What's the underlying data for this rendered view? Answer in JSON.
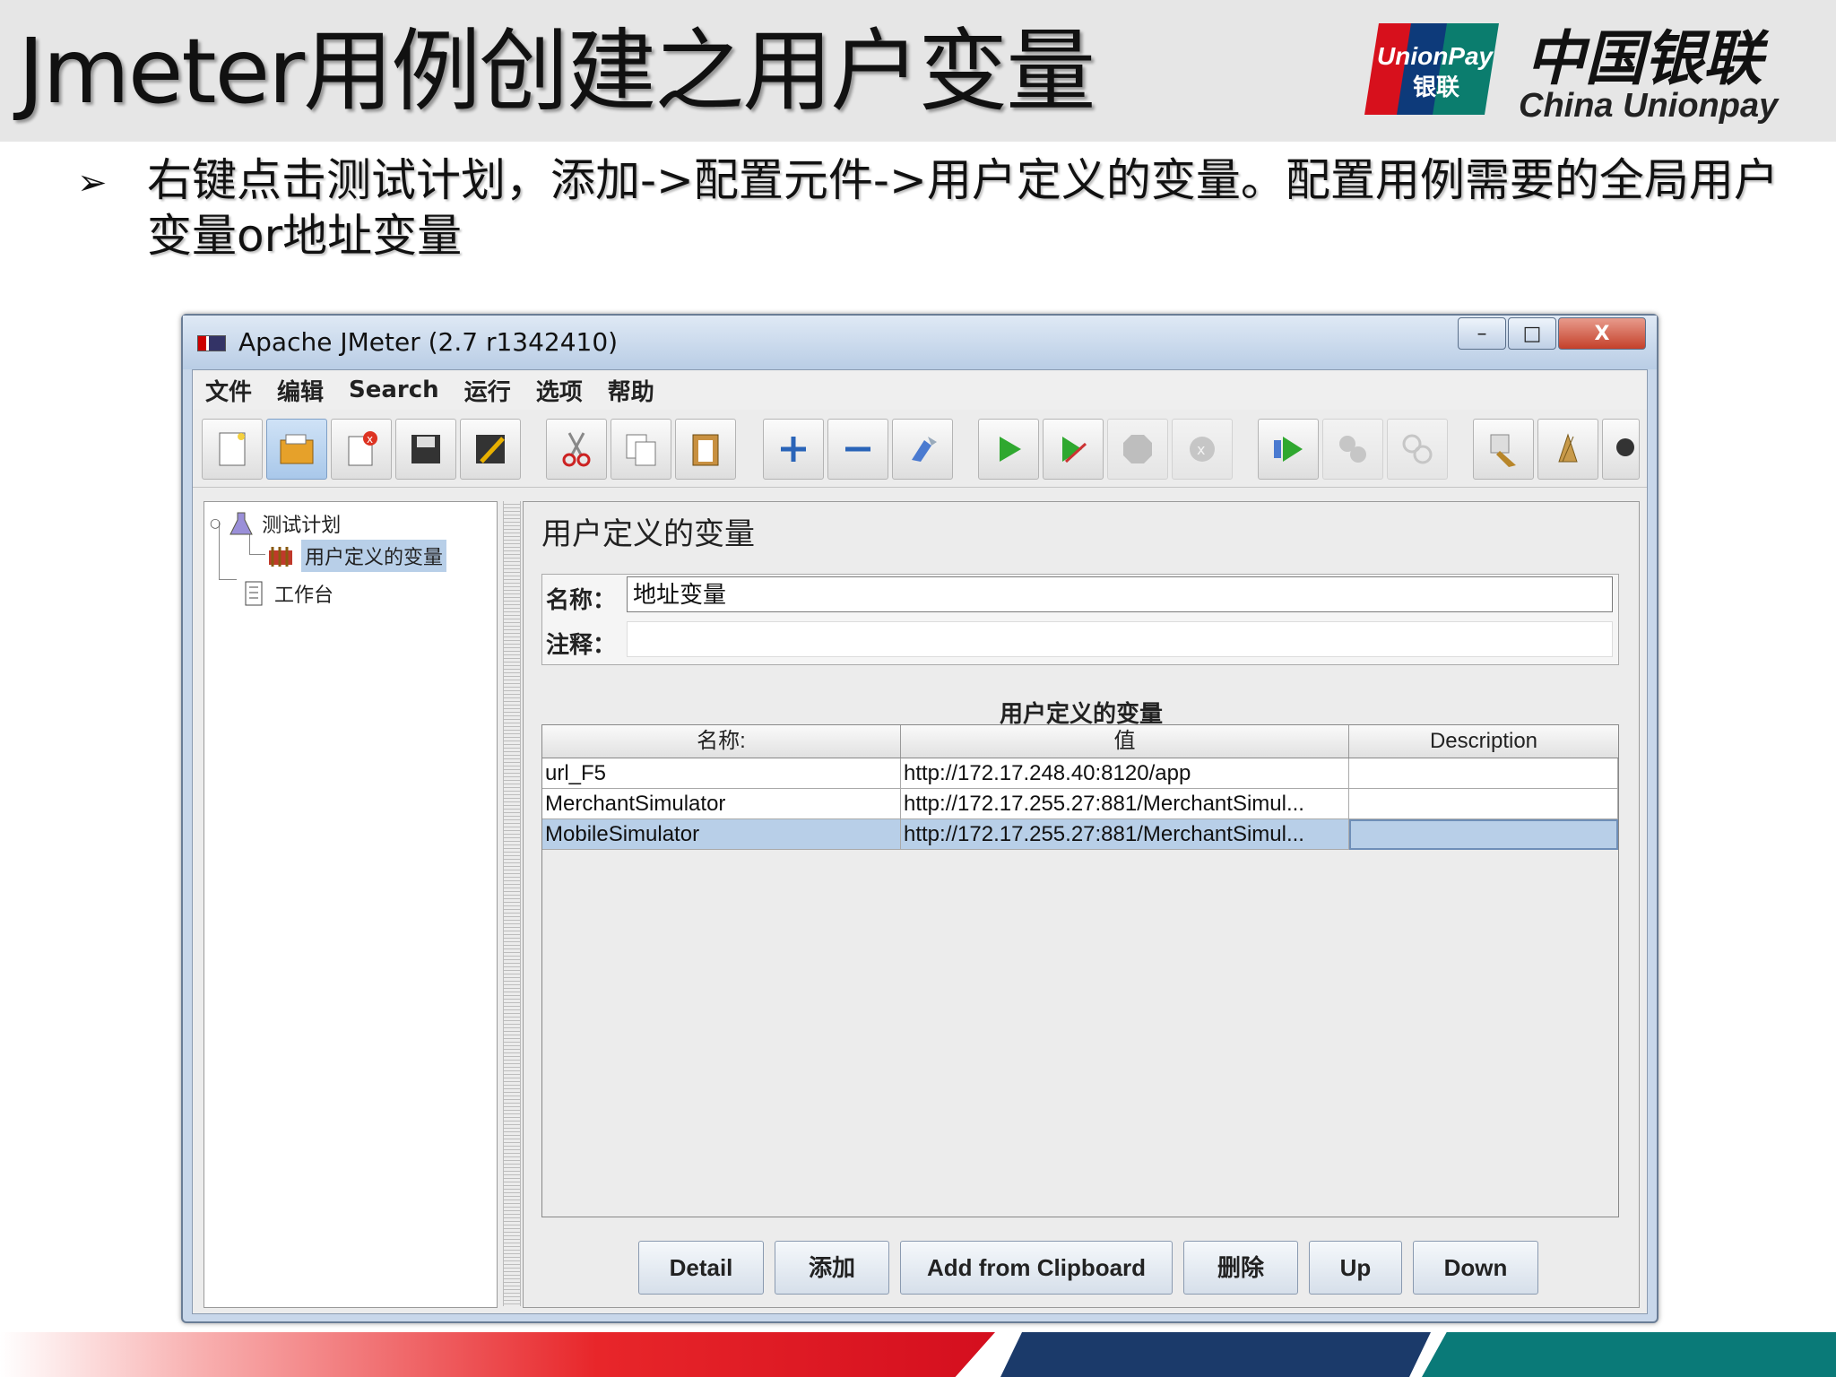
{
  "slide": {
    "title": "Jmeter用例创建之用户变量",
    "logo_cn": "中国银联",
    "logo_en": "China Unionpay",
    "logo_badge": {
      "line1": "UnionPay",
      "line2": "银联"
    },
    "bullet_marker": "➢",
    "bullet_text": "右键点击测试计划，添加->配置元件->用户定义的变量。配置用例需要的全局用户变量or地址变量"
  },
  "window": {
    "title": "Apache JMeter (2.7 r1342410)",
    "controls": {
      "minimize": "–",
      "maximize": "□",
      "close": "X"
    }
  },
  "menu": [
    "文件",
    "编辑",
    "Search",
    "运行",
    "选项",
    "帮助"
  ],
  "toolbar_icons": [
    "new-icon",
    "open-icon",
    "close-file-icon",
    "save-icon",
    "save-as-icon",
    "cut-icon",
    "copy-icon",
    "paste-icon",
    "expand-icon",
    "collapse-icon",
    "toggle-icon",
    "start-icon",
    "start-no-pause-icon",
    "stop-icon",
    "shutdown-icon",
    "remote-start-icon",
    "remote-stop-icon",
    "remote-shutdown-icon",
    "clear-icon",
    "clear-all-icon",
    "search-icon"
  ],
  "tree": {
    "items": [
      {
        "label": "测试计划",
        "icon": "flask-icon"
      },
      {
        "label": "用户定义的变量",
        "icon": "config-element-icon",
        "selected": true
      },
      {
        "label": "工作台",
        "icon": "workbench-icon"
      }
    ]
  },
  "panel": {
    "title": "用户定义的变量",
    "name_label": "名称：",
    "name_value": "地址变量",
    "comment_label": "注释：",
    "comment_value": "",
    "section_title": "用户定义的变量",
    "columns": [
      "名称:",
      "值",
      "Description"
    ],
    "rows": [
      {
        "name": "url_F5",
        "value": "http://172.17.248.40:8120/app",
        "description": ""
      },
      {
        "name": "MerchantSimulator",
        "value": "http://172.17.255.27:881/MerchantSimul...",
        "description": ""
      },
      {
        "name": "MobileSimulator",
        "value": "http://172.17.255.27:881/MerchantSimul...",
        "description": "",
        "selected": true
      }
    ],
    "buttons": {
      "detail": "Detail",
      "add": "添加",
      "add_clipboard": "Add from Clipboard",
      "delete": "删除",
      "up": "Up",
      "down": "Down"
    }
  },
  "colors": {
    "header_bg": "#e6e6e6",
    "selection": "#b8cfe8",
    "footer_red": "#d40e1e",
    "footer_navy": "#1b3a6a",
    "footer_teal": "#0a7a78"
  }
}
